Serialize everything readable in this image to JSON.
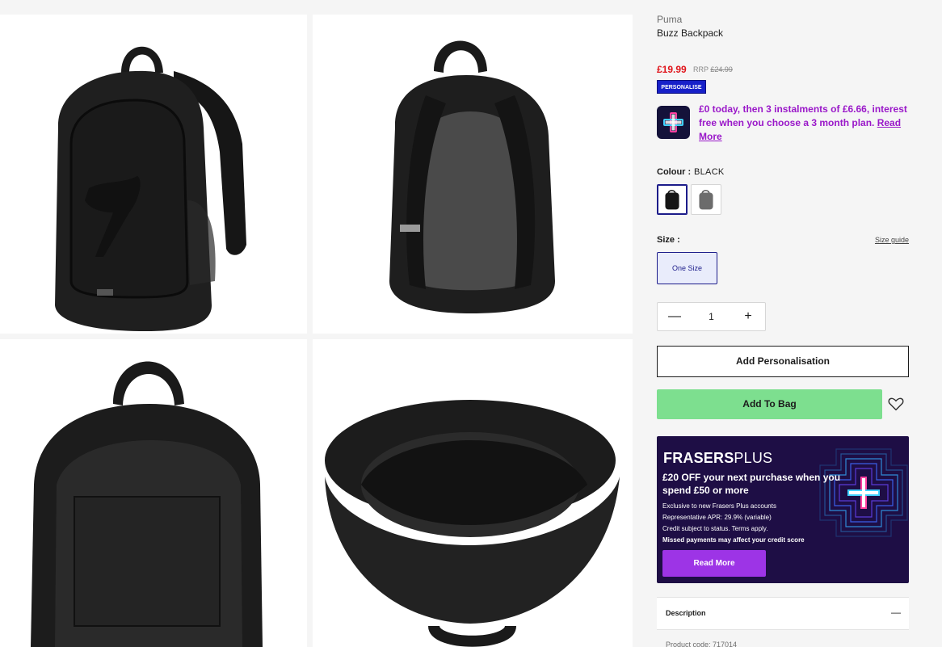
{
  "product": {
    "brand": "Puma",
    "name": "Buzz Backpack",
    "price": "£19.99",
    "rrp_label": "RRP",
    "rrp_value": "£24.99",
    "personalise_badge": "PERSONALISE"
  },
  "promo": {
    "text": "£0 today, then 3 instalments of £6.66, interest free when you choose a 3 month plan.",
    "link": "Read More"
  },
  "colour": {
    "label": "Colour :",
    "value": "BLACK",
    "swatches": [
      "black",
      "grey"
    ]
  },
  "size": {
    "label": "Size :",
    "guide": "Size guide",
    "selected": "One Size"
  },
  "quantity": {
    "minus": "—",
    "value": "1",
    "plus": "+"
  },
  "actions": {
    "add_personalisation": "Add Personalisation",
    "add_to_bag": "Add To Bag"
  },
  "frasers_plus": {
    "logo_bold": "FRASERS",
    "logo_light": "PLUS",
    "headline": "£20 OFF your next purchase when you spend £50 or more",
    "line1": "Exclusive to new Frasers Plus accounts",
    "line2": "Representative APR: 29.9% (variable)",
    "line3": "Credit subject to status. Terms apply.",
    "line4": "Missed payments may affect your credit score",
    "button": "Read More"
  },
  "description": {
    "title": "Description",
    "toggle": "—",
    "product_code": "Product code: 717014"
  },
  "colors": {
    "price_red": "#e0151b",
    "promo_purple": "#9a18c9",
    "add_to_bag_green": "#7ddf8f",
    "badge_blue": "#1720c9",
    "frasers_bg": "#1e0e45",
    "frasers_button": "#9d34e6"
  }
}
